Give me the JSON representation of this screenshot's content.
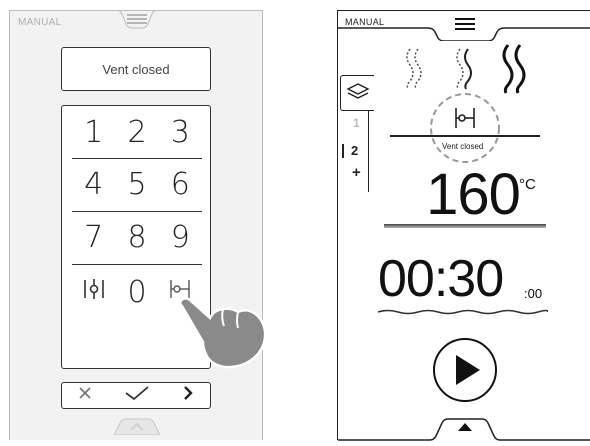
{
  "left_screen": {
    "mode_label": "MANUAL",
    "vent_status": "Vent closed",
    "keypad": {
      "rows": [
        [
          "1",
          "2",
          "3"
        ],
        [
          "4",
          "5",
          "6"
        ],
        [
          "7",
          "8",
          "9"
        ]
      ],
      "zero": "0",
      "vent_open_icon": "vent-open-icon",
      "vent_closed_icon": "vent-closed-icon"
    },
    "bottom_bar": {
      "cancel_icon": "close-icon",
      "confirm_icon": "check-icon",
      "next_icon": "chevron-right-icon"
    },
    "colors": {
      "panel_bg": "#f2f2f2",
      "border": "#333333",
      "hand": "#8a8a8a"
    }
  },
  "right_screen": {
    "mode_label": "MANUAL",
    "vent_status": "Vent closed",
    "shelf_levels": [
      "1",
      "2",
      "+"
    ],
    "selected_level": "2",
    "temperature": {
      "value": "160",
      "unit": "°C"
    },
    "timer": {
      "value": "00:30",
      "seconds": ":00"
    },
    "steam_levels": {
      "total": 3,
      "active_icon": "steam-high-icon"
    },
    "icons": [
      "menu-icon",
      "layers-icon",
      "vent-closed-icon",
      "play-icon"
    ]
  }
}
